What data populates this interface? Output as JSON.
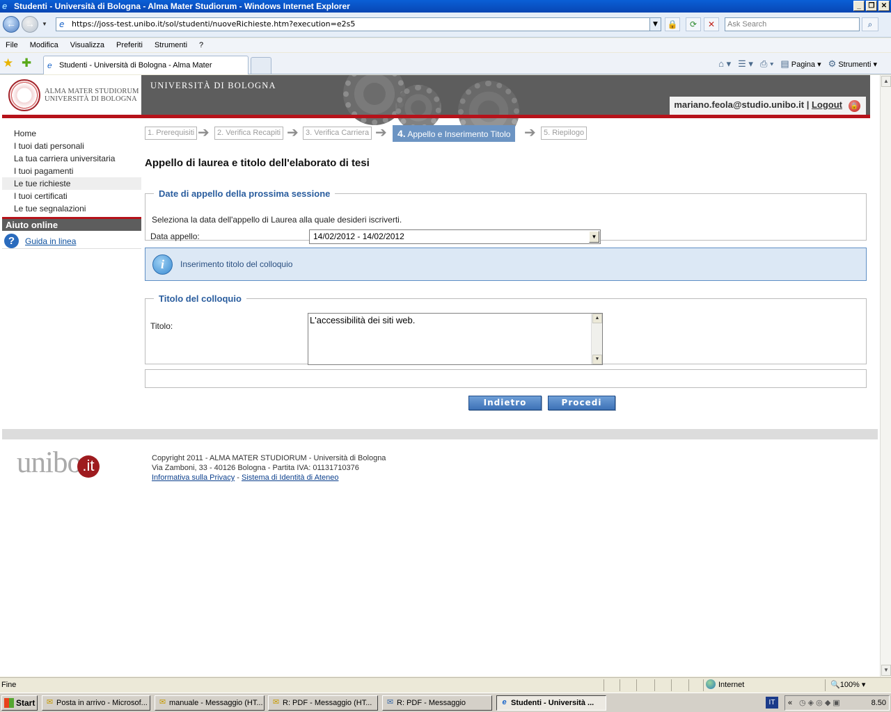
{
  "window": {
    "title": "Studenti - Università di Bologna - Alma Mater Studiorum - Windows Internet Explorer",
    "address": "https://joss-test.unibo.it/sol/studenti/nuoveRichieste.htm?execution=e2s5",
    "search_placeholder": "Ask Search",
    "menu": [
      "File",
      "Modifica",
      "Visualizza",
      "Preferiti",
      "Strumenti",
      "?"
    ],
    "tab_title": "Studenti - Università di Bologna - Alma Mater Studiorum",
    "cmd_pagina": "Pagina",
    "cmd_strumenti": "Strumenti"
  },
  "header": {
    "alma_line1": "ALMA MATER STUDIORUM",
    "alma_line2": "UNIVERSITÀ DI BOLOGNA",
    "univ": "UNIVERSITÀ DI BOLOGNA",
    "user": "mariano.feola@studio.unibo.it",
    "separator": "|",
    "logout": "Logout"
  },
  "sidebar": {
    "items": [
      {
        "label": "Home"
      },
      {
        "label": "I tuoi dati personali"
      },
      {
        "label": "La tua carriera universitaria"
      },
      {
        "label": "I tuoi pagamenti"
      },
      {
        "label": "Le tue richieste"
      },
      {
        "label": "I tuoi certificati"
      },
      {
        "label": "Le tue segnalazioni"
      }
    ],
    "help_title": "Aiuto online",
    "help_link": "Guida in linea"
  },
  "steps": {
    "s1": "1. Prerequisiti",
    "s2": "2. Verifica Recapiti",
    "s3": "3. Verifica Carriera",
    "s4_num": "4.",
    "s4_label": "Appello e Inserimento Titolo",
    "s5": "5. Riepilogo"
  },
  "main": {
    "title": "Appello di laurea e titolo dell'elaborato di tesi",
    "appello": {
      "legend": "Date di appello della prossima sessione",
      "instruction": "Seleziona la data dell'appello di Laurea alla quale desideri iscriverti.",
      "label": "Data appello:",
      "selected": "14/02/2012 - 14/02/2012"
    },
    "info": "Inserimento titolo del colloquio",
    "titolo": {
      "legend": "Titolo del colloquio",
      "label": "Titolo:",
      "value": "L'accessibilità dei siti web."
    },
    "buttons": {
      "back": "Indietro",
      "next": "Procedi"
    }
  },
  "footer": {
    "logo_text": "unibo",
    "logo_suffix": ".it",
    "line1": "Copyright 2011 - ALMA MATER STUDIORUM - Università di Bologna",
    "line2": "Via Zamboni, 33 - 40126 Bologna - Partita IVA: 01131710376",
    "privacy": "Informativa sulla Privacy",
    "dash": "-",
    "identity": "Sistema di Identità di Ateneo"
  },
  "statusbar": {
    "status": "Fine",
    "zone": "Internet",
    "zoom": "100%"
  },
  "taskbar": {
    "start": "Start",
    "tasks": [
      {
        "label": "Posta in arrivo - Microsof..."
      },
      {
        "label": "manuale - Messaggio (HT..."
      },
      {
        "label": "R: PDF - Messaggio (HT..."
      },
      {
        "label": "R: PDF - Messaggio"
      },
      {
        "label": "Studenti - Università ..."
      }
    ],
    "lang": "IT",
    "clock": "8.50"
  }
}
